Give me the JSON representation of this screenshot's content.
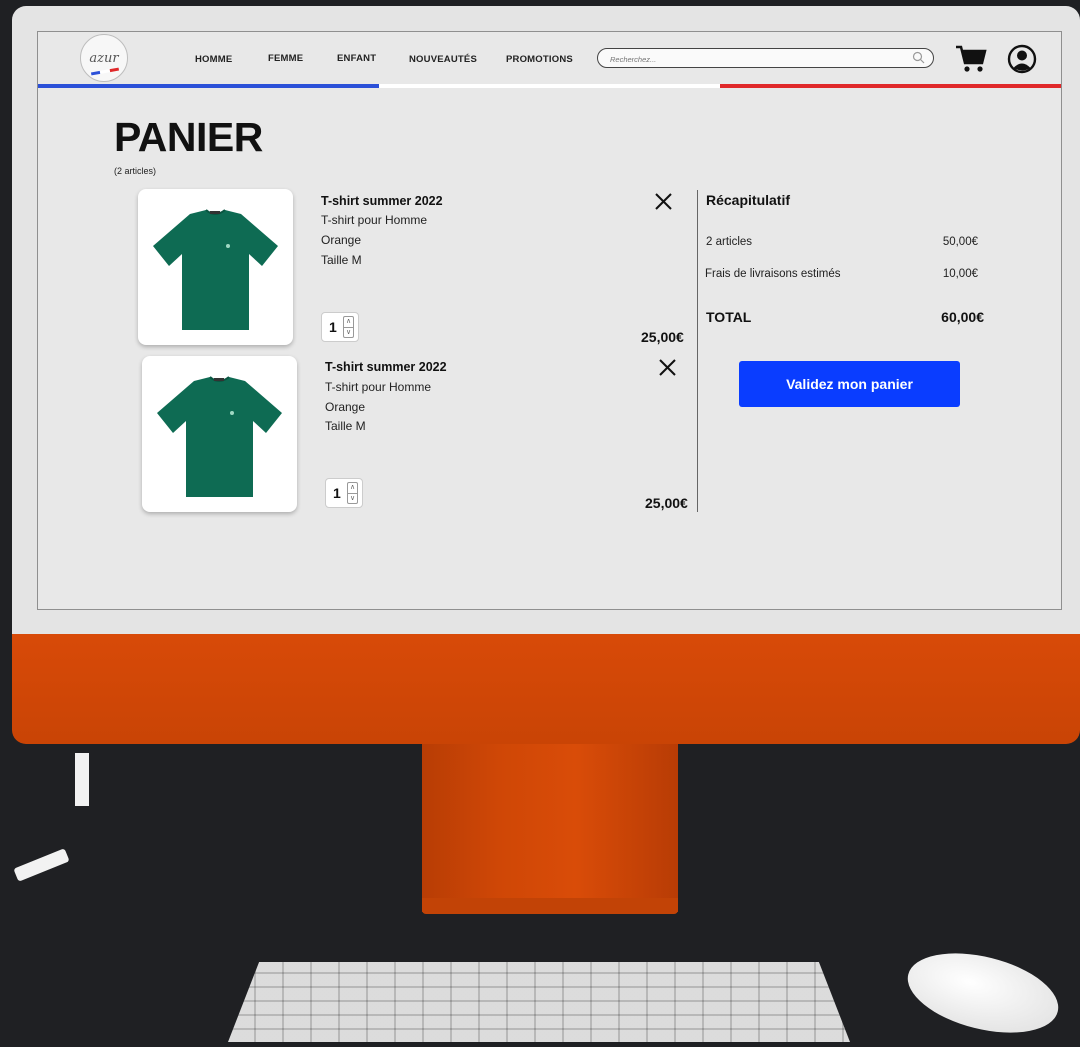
{
  "brand": {
    "logo_text": "azur",
    "flag_colors": [
      "#2b50d8",
      "#ffffff",
      "#e0282a"
    ]
  },
  "nav": {
    "items": [
      {
        "label": "HOMME"
      },
      {
        "label": "FEMME"
      },
      {
        "label": "ENFANT"
      },
      {
        "label": "NOUVEAUTÉS"
      },
      {
        "label": "PROMOTIONS"
      }
    ],
    "search_placeholder": "Recherchez...",
    "icons": [
      "search-icon",
      "cart-icon",
      "user-icon"
    ]
  },
  "cart": {
    "title": "PANIER",
    "count_text": "(2 articles)",
    "items": [
      {
        "name": "T-shirt summer 2022",
        "type": "T-shirt pour Homme",
        "color": "Orange",
        "size": "Taille M",
        "quantity": "1",
        "price": "25,00€",
        "image_color": "#0e6b53"
      },
      {
        "name": "T-shirt summer 2022",
        "type": "T-shirt pour Homme",
        "color": "Orange",
        "size": "Taille M",
        "quantity": "1",
        "price": "25,00€",
        "image_color": "#0e6b53"
      }
    ]
  },
  "summary": {
    "title": "Récapitulatif",
    "articles_label": "2 articles",
    "articles_value": "50,00€",
    "shipping_label": "Frais de livraisons estimés",
    "shipping_value": "10,00€",
    "total_label": "TOTAL",
    "total_value": "60,00€",
    "validate_label": "Validez mon panier",
    "accent": "#0a3dff"
  },
  "device": {
    "color": "#d14a07"
  }
}
